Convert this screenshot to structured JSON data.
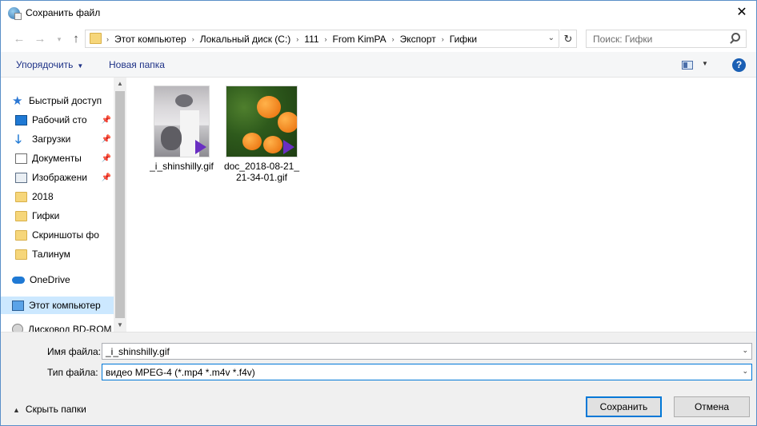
{
  "window": {
    "title": "Сохранить файл",
    "close_label": "✕"
  },
  "address": {
    "crumbs": [
      "Этот компьютер",
      "Локальный диск (C:)",
      "111",
      "From KimPA",
      "Экспорт",
      "Гифки"
    ]
  },
  "search": {
    "placeholder": "Поиск: Гифки"
  },
  "toolbar": {
    "organize_label": "Упорядочить",
    "new_folder_label": "Новая папка",
    "help_label": "?"
  },
  "nav": {
    "quick_access": "Быстрый доступ",
    "items": [
      {
        "label": "Рабочий сто",
        "pinned": true
      },
      {
        "label": "Загрузки",
        "pinned": true
      },
      {
        "label": "Документы",
        "pinned": true
      },
      {
        "label": "Изображени",
        "pinned": true
      },
      {
        "label": "2018",
        "pinned": false
      },
      {
        "label": "Гифки",
        "pinned": false
      },
      {
        "label": "Скриншоты фо",
        "pinned": false
      },
      {
        "label": "Талинум",
        "pinned": false
      }
    ],
    "onedrive": "OneDrive",
    "this_pc": "Этот компьютер",
    "drive": "Дисковод BD-ROM"
  },
  "files": [
    {
      "name": "_i_shinshilly.gif",
      "thumb": "cats"
    },
    {
      "name": "doc_2018-08-21_21-34-01.gif",
      "thumb": "oranges"
    }
  ],
  "form": {
    "filename_label": "Имя файла:",
    "filename_value": "_i_shinshilly.gif",
    "filetype_label": "Тип файла:",
    "filetype_value": "видео MPEG-4 (*.mp4 *.m4v *.f4v)",
    "hide_folders_label": "Скрыть папки",
    "save_label": "Сохранить",
    "cancel_label": "Отмена"
  }
}
